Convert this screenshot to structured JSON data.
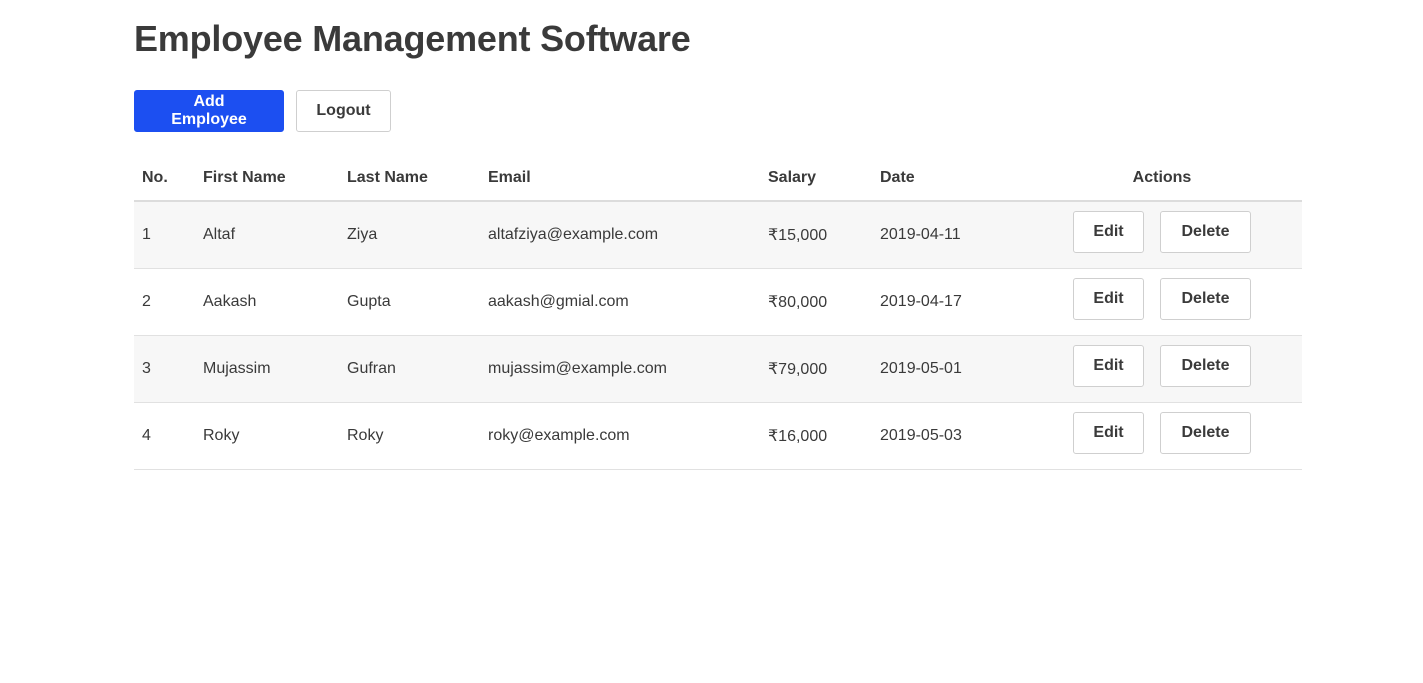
{
  "header": {
    "title": "Employee Management Software"
  },
  "toolbar": {
    "add_label": "Add Employee",
    "logout_label": "Logout"
  },
  "table": {
    "headers": [
      "No.",
      "First Name",
      "Last Name",
      "Email",
      "Salary",
      "Date",
      "Actions"
    ],
    "rows": [
      {
        "no": "1",
        "first": "Altaf",
        "last": "Ziya",
        "email": "altafziya@example.com",
        "salary": "₹15,000",
        "date": "2019-04-11"
      },
      {
        "no": "2",
        "first": "Aakash",
        "last": "Gupta",
        "email": "aakash@gmial.com",
        "salary": "₹80,000",
        "date": "2019-04-17"
      },
      {
        "no": "3",
        "first": "Mujassim",
        "last": "Gufran",
        "email": "mujassim@example.com",
        "salary": "₹79,000",
        "date": "2019-05-01"
      },
      {
        "no": "4",
        "first": "Roky",
        "last": "Roky",
        "email": "roky@example.com",
        "salary": "₹16,000",
        "date": "2019-05-03"
      }
    ],
    "edit_label": "Edit",
    "delete_label": "Delete"
  },
  "colors": {
    "primary": "#1c4ff1",
    "stripe": "#f7f7f7",
    "text": "#3a3a3a"
  }
}
